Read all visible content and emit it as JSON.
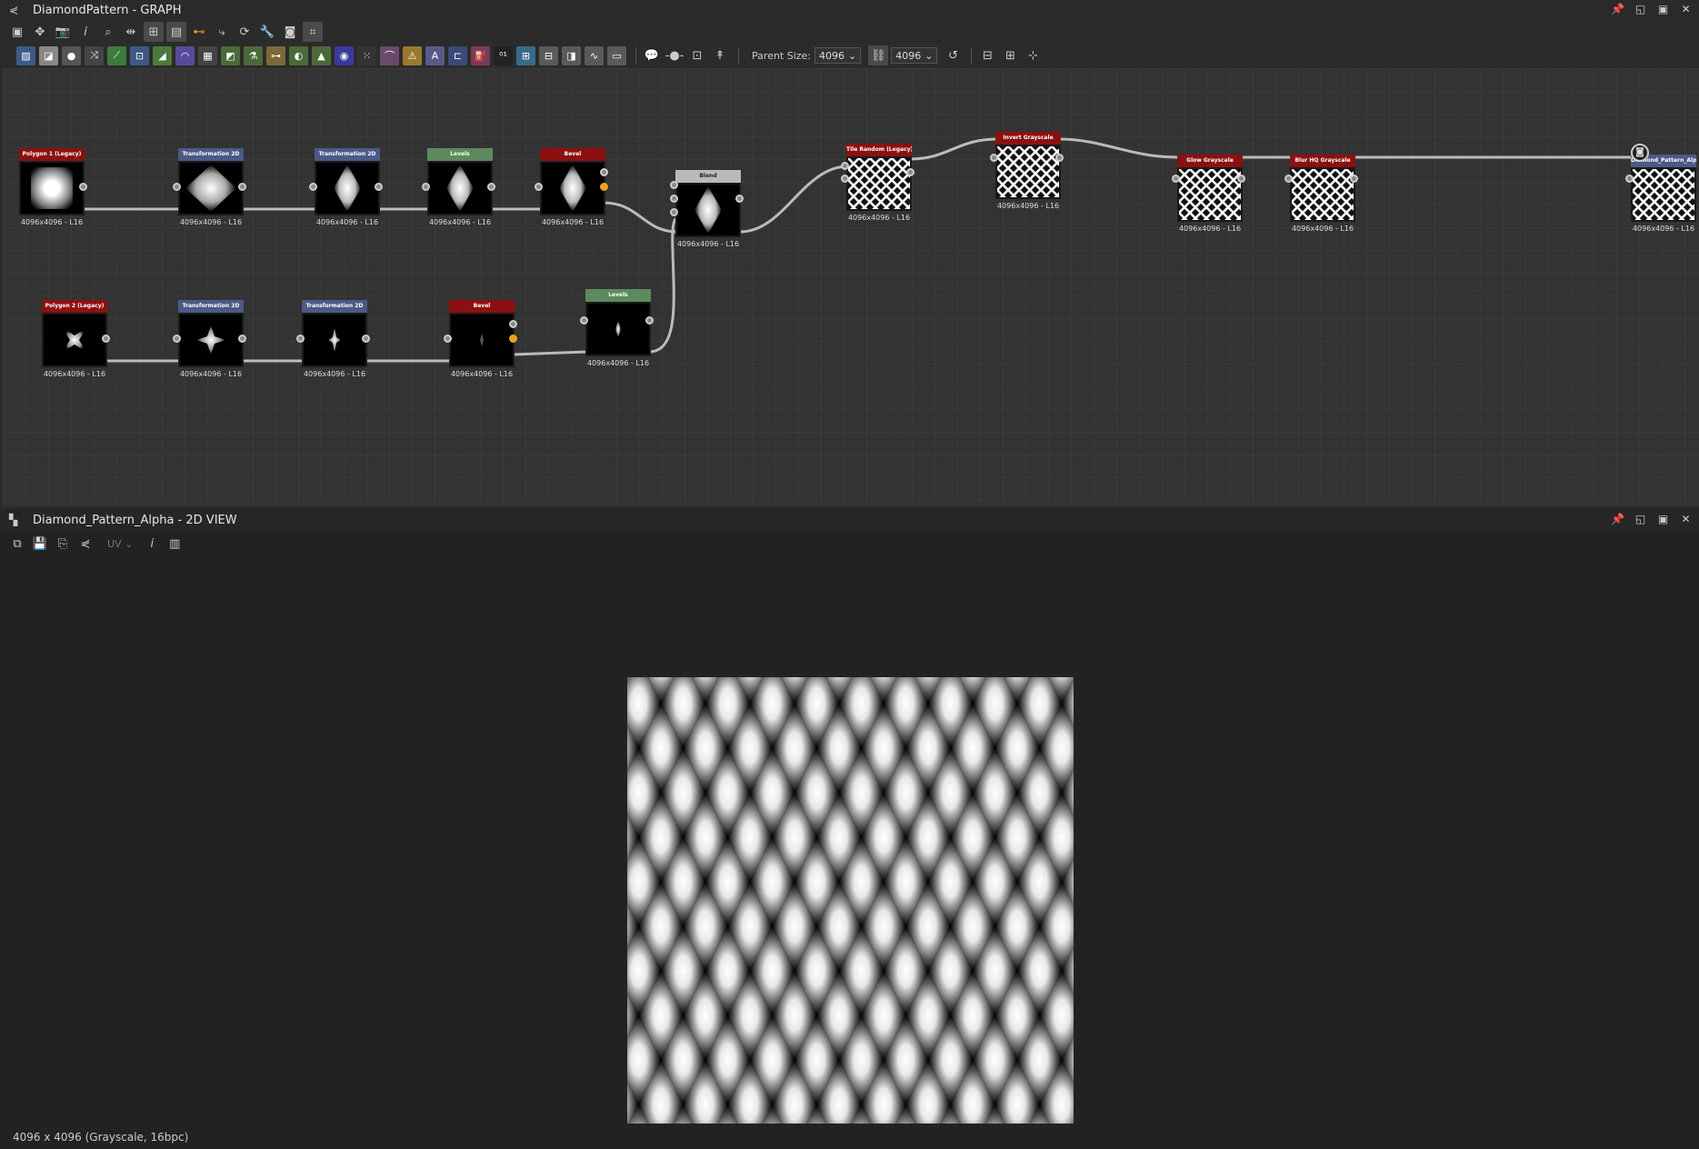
{
  "graph_panel": {
    "title": "DiamondPattern - GRAPH",
    "title_icon": "graph-icon",
    "parent_size_label": "Parent Size:",
    "parent_width": "4096",
    "parent_height": "4096"
  },
  "view_panel": {
    "title": "Diamond_Pattern_Alpha - 2D VIEW",
    "uv_label": "UV",
    "status": "4096 x 4096 (Grayscale, 16bpc)"
  },
  "nodes": {
    "n1": {
      "title": "Polygon 1 (Legacy)",
      "caption": "4096x4096 - L16"
    },
    "n2": {
      "title": "Transformation 2D",
      "caption": "4096x4096 - L16"
    },
    "n3": {
      "title": "Transformation 2D",
      "caption": "4096x4096 - L16"
    },
    "n4": {
      "title": "Levels",
      "caption": "4096x4096 - L16"
    },
    "n5": {
      "title": "Bevel",
      "caption": "4096x4096 - L16"
    },
    "n6": {
      "title": "Blend",
      "caption": "4096x4096 - L16"
    },
    "n7": {
      "title": "Tile Random (Legacy)",
      "caption": "4096x4096 - L16"
    },
    "n8": {
      "title": "Invert Grayscale",
      "caption": "4096x4096 - L16"
    },
    "n9": {
      "title": "Glow Grayscale",
      "caption": "4096x4096 - L16"
    },
    "n10": {
      "title": "Blur HQ Grayscale",
      "caption": "4096x4096 - L16"
    },
    "n11": {
      "title": "Diamond_Pattern_Alpha",
      "caption": "4096x4096 - L16"
    },
    "m1": {
      "title": "Polygon 2 (Legacy)",
      "caption": "4096x4096 - L16"
    },
    "m2": {
      "title": "Transformation 2D",
      "caption": "4096x4096 - L16"
    },
    "m3": {
      "title": "Transformation 2D",
      "caption": "4096x4096 - L16"
    },
    "m4": {
      "title": "Bevel",
      "caption": "4096x4096 - L16"
    },
    "m5": {
      "title": "Levels",
      "caption": "4096x4096 - L16"
    }
  },
  "colors": {
    "node_red": "#8c1010",
    "node_blue": "#4b5a86",
    "node_green": "#5d8a5d",
    "port_orange": "#f0a020",
    "canvas_bg": "#333333"
  }
}
